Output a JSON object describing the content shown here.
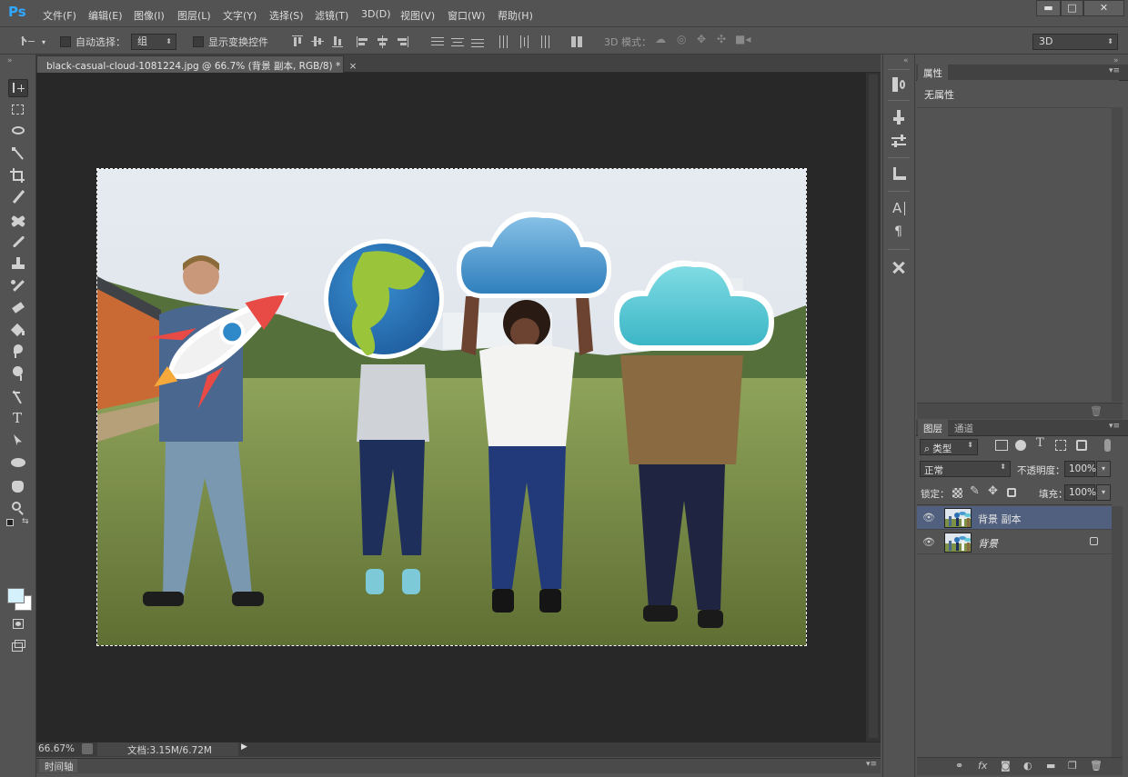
{
  "app": {
    "logo": "Ps"
  },
  "menu": [
    "文件(F)",
    "编辑(E)",
    "图像(I)",
    "图层(L)",
    "文字(Y)",
    "选择(S)",
    "滤镜(T)",
    "3D(D)",
    "视图(V)",
    "窗口(W)",
    "帮助(H)"
  ],
  "window_controls": {
    "minimize": "▬",
    "maximize": "□",
    "close": "✕"
  },
  "options_bar": {
    "auto_select_label": "自动选择：",
    "auto_select_value": "组",
    "show_transform_label": "显示变换控件",
    "mode3d_label": "3D 模式：",
    "workspace_value": "3D"
  },
  "document": {
    "tab_title": "black-casual-cloud-1081224.jpg @ 66.7% (背景 副本, RGB/8) *",
    "close_glyph": "×"
  },
  "status": {
    "zoom": "66.67%",
    "doc_info": "文档:3.15M/6.72M",
    "timeline_label": "时间轴"
  },
  "properties_panel": {
    "tab": "属性",
    "empty_text": "无属性"
  },
  "layers_panel": {
    "tabs": [
      "图层",
      "通道"
    ],
    "filter_value": "类型",
    "blend_mode": "正常",
    "opacity_label": "不透明度：",
    "opacity_value": "100%",
    "lock_label": "锁定：",
    "fill_label": "填充：",
    "fill_value": "100%",
    "layers": [
      {
        "name": "背景 副本",
        "selected": true,
        "locked": false
      },
      {
        "name": "背景",
        "selected": false,
        "locked": true
      }
    ]
  },
  "panel_collapse_glyph": "«",
  "panel_expand_glyph": "»",
  "colors": {
    "ui_bg": "#535353",
    "canvas_bg": "#282828",
    "selected_layer": "#50607e",
    "ps_blue": "#31a8ff",
    "sky": "#dfe6ee",
    "grass": "#7d9146",
    "earth_blue": "#2a6fb2",
    "cloud_blue": "#4b9bd0",
    "cloud_cyan": "#5fc9d6",
    "rocket_red": "#e84a45"
  }
}
